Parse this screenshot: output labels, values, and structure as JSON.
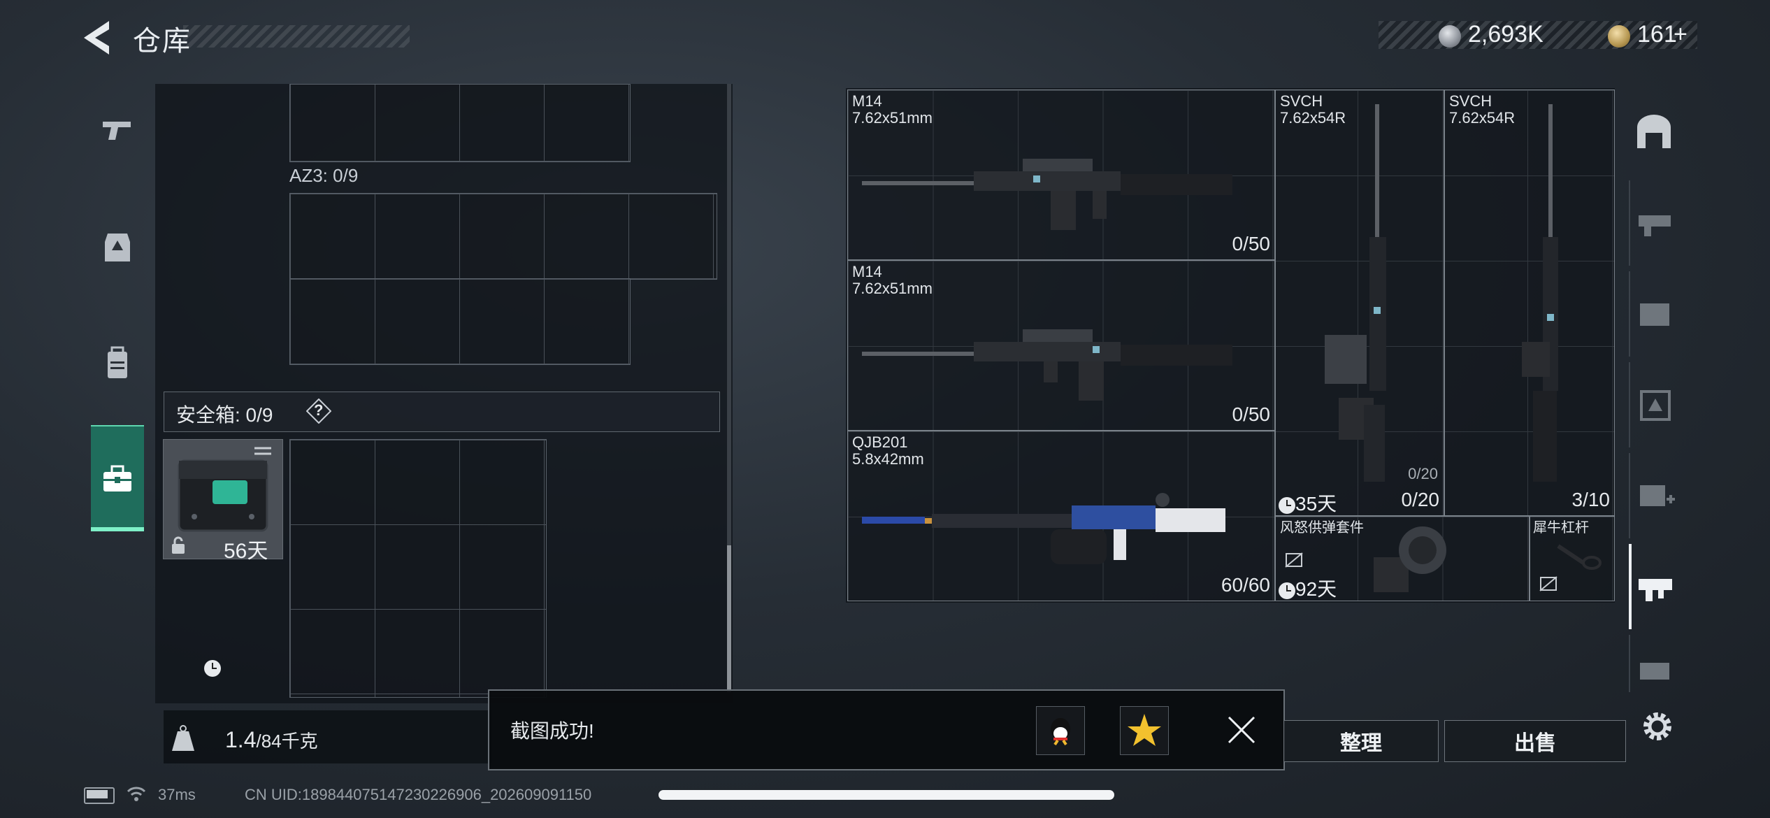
{
  "header": {
    "title": "仓库",
    "currency_silver": "2,693K",
    "currency_gold": "161",
    "add_label": "+"
  },
  "storage": {
    "az3_label": "AZ3: 0/9",
    "safe_box_label": "安全箱:  0/9",
    "safe_help": "?",
    "safe_box_item_days": "56天"
  },
  "weight": {
    "current": "1.4",
    "max": "/84千克"
  },
  "weapons": [
    {
      "name": "M14",
      "caliber": "7.62x51mm",
      "ammo": "0/50"
    },
    {
      "name": "M14",
      "caliber": "7.62x51mm",
      "ammo": "0/50"
    },
    {
      "name": "QJB201",
      "caliber": "5.8x42mm",
      "ammo": "60/60"
    },
    {
      "name": "SVCH",
      "caliber": "7.62x54R",
      "ammo": "0/20",
      "ammo_small": "0/20",
      "days": "35天"
    },
    {
      "name": "SVCH",
      "caliber": "7.62x54R",
      "ammo": "3/10"
    }
  ],
  "attachments": [
    {
      "name": "风怒供弹套件",
      "days": "92天"
    },
    {
      "name": "犀牛杠杆"
    }
  ],
  "toast": {
    "text": "截图成功!"
  },
  "actions": {
    "sort_label": "整理",
    "sell_label": "出售"
  },
  "status": {
    "ping": "37ms",
    "uid": "CN UID:189844075147230226906_202609091150"
  },
  "colors": {
    "accent": "#1f6d5c",
    "accent_light": "#7ef0c8"
  }
}
